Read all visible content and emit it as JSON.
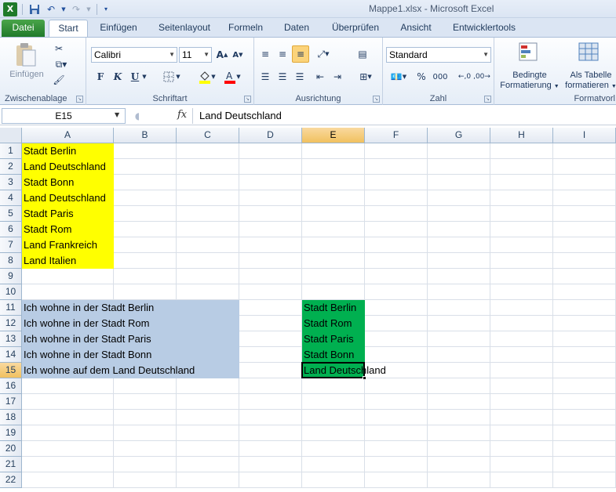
{
  "window_title": "Mappe1.xlsx - Microsoft Excel",
  "tabs": [
    "Datei",
    "Start",
    "Einfügen",
    "Seitenlayout",
    "Formeln",
    "Daten",
    "Überprüfen",
    "Ansicht",
    "Entwicklertools"
  ],
  "active_tab": "Start",
  "ribbon": {
    "clipboard": {
      "label": "Zwischenablage",
      "paste_label": "Einfügen"
    },
    "font": {
      "label": "Schriftart",
      "font_name": "Calibri",
      "font_size": "11",
      "bold": "F",
      "italic": "K",
      "underline": "U"
    },
    "alignment": {
      "label": "Ausrichtung"
    },
    "number": {
      "label": "Zahl",
      "format": "Standard",
      "percent": "%",
      "thousands": "000"
    },
    "styles": {
      "conditional_line1": "Bedingte",
      "conditional_line2": "Formatierung",
      "table_line1": "Als Tabelle",
      "table_line2": "formatieren",
      "group_label": "Formatvorl"
    }
  },
  "formula_bar": {
    "name_box": "E15",
    "fx": "fx",
    "value": "Land Deutschland"
  },
  "columns": [
    "A",
    "B",
    "C",
    "D",
    "E",
    "F",
    "G",
    "H",
    "I"
  ],
  "rows": [
    "1",
    "2",
    "3",
    "4",
    "5",
    "6",
    "7",
    "8",
    "9",
    "10",
    "11",
    "12",
    "13",
    "14",
    "15",
    "16",
    "17",
    "18",
    "19",
    "20",
    "21",
    "22"
  ],
  "selected_cell": {
    "col": "E",
    "row": "15"
  },
  "colors": {
    "yellow": "#FFFF00",
    "blue": "#B8CCE4",
    "green": "#00B050"
  },
  "cells": {
    "A1": "Stadt Berlin",
    "A2": "Land Deutschland",
    "A3": "Stadt Bonn",
    "A4": "Land Deutschland",
    "A5": "Stadt Paris",
    "A6": "Stadt Rom",
    "A7": "Land Frankreich",
    "A8": "Land Italien",
    "A11": "Ich wohne in der Stadt Berlin",
    "A12": "Ich wohne in der Stadt Rom",
    "A13": "Ich wohne in der Stadt Paris",
    "A14": "Ich wohne in der Stadt Bonn",
    "A15": "Ich wohne auf dem  Land  Deutschland",
    "E11": "Stadt Berlin",
    "E12": "Stadt Rom",
    "E13": "Stadt Paris",
    "E14": "Stadt Bonn",
    "E15": "Land Deutschland"
  }
}
